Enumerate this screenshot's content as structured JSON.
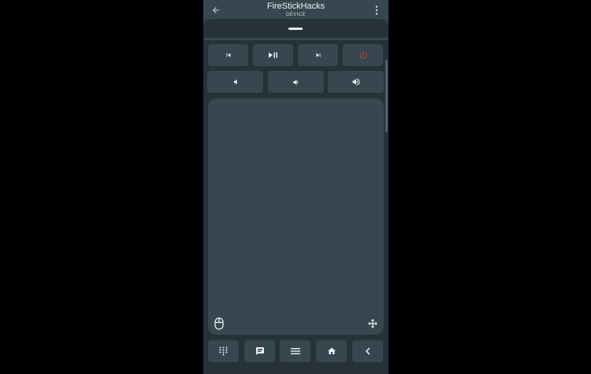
{
  "app_bar": {
    "title": "FireStickHacks",
    "subtitle": "DEVICE",
    "back_icon": "arrow-left-icon",
    "menu_icon": "more-vertical-icon"
  },
  "media_controls": [
    {
      "name": "previous",
      "icon": "skip-previous-icon"
    },
    {
      "name": "play-pause",
      "icon": "play-pause-icon"
    },
    {
      "name": "next",
      "icon": "skip-next-icon"
    },
    {
      "name": "power",
      "icon": "power-icon"
    }
  ],
  "volume_controls": [
    {
      "name": "mute",
      "icon": "volume-mute-icon"
    },
    {
      "name": "volume-down",
      "icon": "volume-down-icon"
    },
    {
      "name": "volume-up",
      "icon": "volume-up-icon"
    }
  ],
  "touchpad": {
    "left_icon": "mouse-icon",
    "right_icon": "dpad-move-icon"
  },
  "bottom_bar": [
    {
      "name": "keypad",
      "icon": "dialpad-icon"
    },
    {
      "name": "keyboard",
      "icon": "message-icon"
    },
    {
      "name": "menu",
      "icon": "menu-icon"
    },
    {
      "name": "home",
      "icon": "home-icon"
    },
    {
      "name": "back",
      "icon": "chevron-left-icon"
    }
  ],
  "colors": {
    "app_bar": "#37474f",
    "sheet": "#263238",
    "button": "#37474f",
    "icon": "#eceff1",
    "power": "#e53935"
  }
}
